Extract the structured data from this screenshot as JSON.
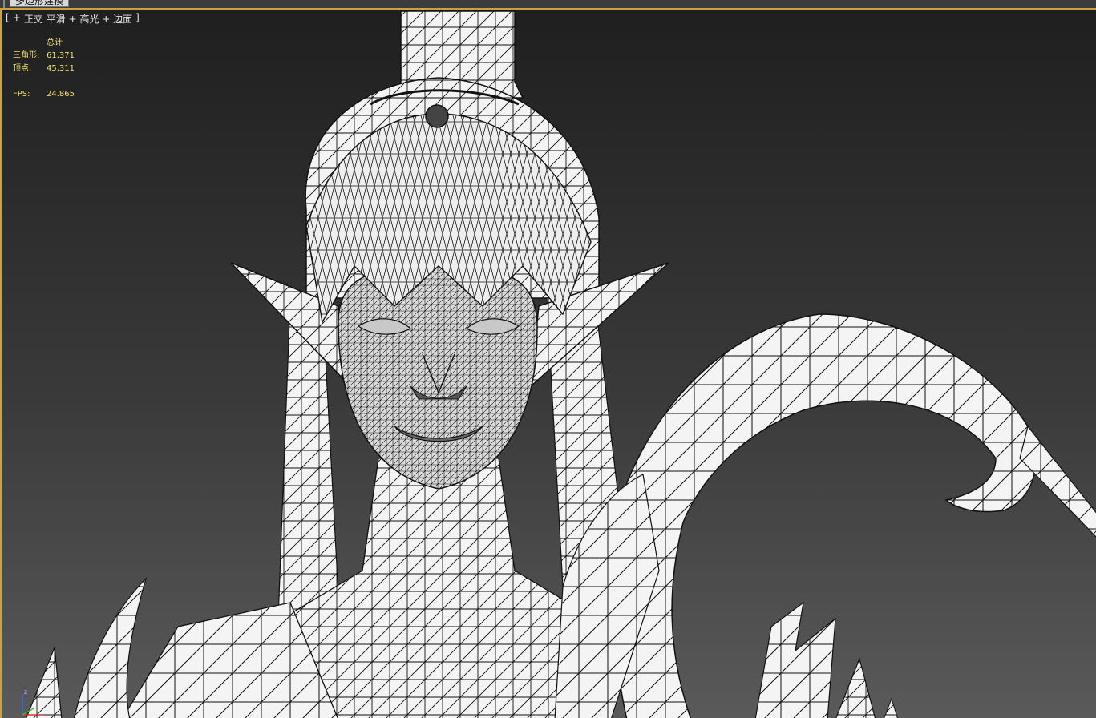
{
  "ribbon": {
    "active_tab": "多边形建模"
  },
  "viewport_label": {
    "open_bracket": "[",
    "plus": "+",
    "view": "正交",
    "shading": "平滑 + 高光 + 边面",
    "close_bracket": "]"
  },
  "stats": {
    "header": "总计",
    "triangles_label": "三角形:",
    "triangles_value": "61,371",
    "vertices_label": "顶点:",
    "vertices_value": "45,311",
    "fps_label": "FPS:",
    "fps_value": "24.865"
  },
  "axis_gizmo": {
    "z_label": "z"
  },
  "colors": {
    "viewport_border": "#c9a43a",
    "stats_text": "#f0e070",
    "mesh_fill": "#f4f4f4",
    "wire": "#111111"
  }
}
